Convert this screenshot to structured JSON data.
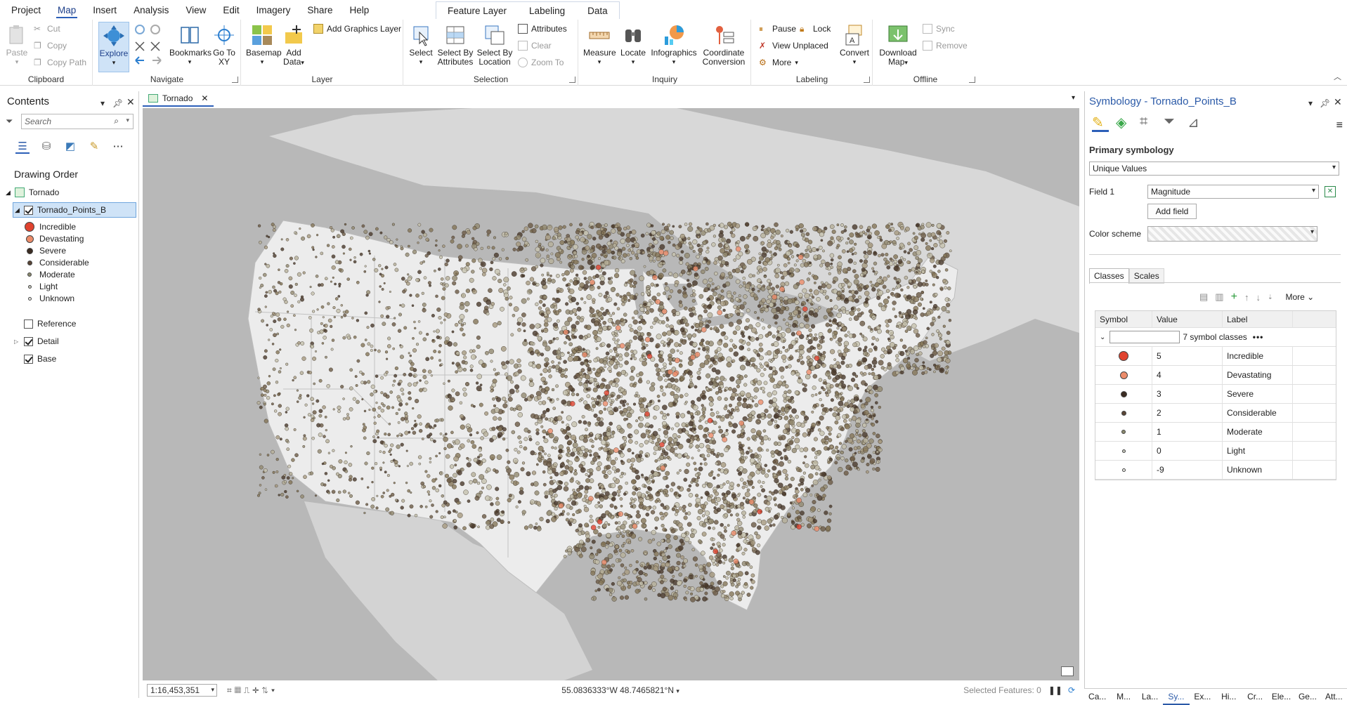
{
  "ribbon_tabs": [
    "Project",
    "Map",
    "Insert",
    "Analysis",
    "View",
    "Edit",
    "Imagery",
    "Share",
    "Help"
  ],
  "active_tab": "Map",
  "context_tabs": [
    "Feature Layer",
    "Labeling",
    "Data"
  ],
  "clipboard": {
    "paste": "Paste",
    "cut": "Cut",
    "copy": "Copy",
    "copy_path": "Copy Path",
    "label": "Clipboard"
  },
  "navigate": {
    "explore": "Explore",
    "bookmarks": "Bookmarks",
    "go_to_xy": "Go To XY",
    "label": "Navigate"
  },
  "layer": {
    "basemap": "Basemap",
    "add_data": "Add Data",
    "add_graphics": "Add Graphics Layer",
    "label": "Layer"
  },
  "selection": {
    "select": "Select",
    "select_by_attributes": "Select By Attributes",
    "select_by_location": "Select By Location",
    "attributes": "Attributes",
    "clear": "Clear",
    "zoom_to": "Zoom To",
    "label": "Selection"
  },
  "inquiry": {
    "measure": "Measure",
    "locate": "Locate",
    "infographics": "Infographics",
    "coord_conversion": "Coordinate Conversion",
    "label": "Inquiry"
  },
  "labeling": {
    "pause": "Pause",
    "lock": "Lock",
    "view_unplaced": "View Unplaced",
    "more": "More",
    "convert": "Convert",
    "label": "Labeling"
  },
  "offline": {
    "download_map": "Download Map",
    "sync": "Sync",
    "remove": "Remove",
    "label": "Offline"
  },
  "contents": {
    "title": "Contents",
    "search_placeholder": "Search",
    "drawing_order": "Drawing Order",
    "map_name": "Tornado",
    "layer_name": "Tornado_Points_B",
    "legend": [
      {
        "label": "Incredible",
        "color": "#e0432f"
      },
      {
        "label": "Devastating",
        "color": "#ec8c6a"
      },
      {
        "label": "Severe",
        "color": "#3b2c22"
      },
      {
        "label": "Considerable",
        "color": "#5a4535"
      },
      {
        "label": "Moderate",
        "color": "#8b8a6e"
      },
      {
        "label": "Light",
        "color": "#c9cbbf"
      },
      {
        "label": "Unknown",
        "color": "#ecece6"
      }
    ],
    "other_layers": [
      {
        "label": "Reference",
        "checked": false
      },
      {
        "label": "Detail",
        "checked": true
      },
      {
        "label": "Base",
        "checked": true
      }
    ]
  },
  "map": {
    "tab_label": "Tornado",
    "scale": "1:16,453,351",
    "coordinates": "55.0836333°W 48.7465821°N",
    "selected_features": "Selected Features: 0"
  },
  "symbology": {
    "title": "Symbology - Tornado_Points_B",
    "primary_label": "Primary symbology",
    "primary_value": "Unique Values",
    "field1_label": "Field 1",
    "field1_value": "Magnitude",
    "add_field": "Add field",
    "color_scheme_label": "Color scheme",
    "tabs": [
      "Classes",
      "Scales"
    ],
    "more": "More",
    "headers": [
      "Symbol",
      "Value",
      "Label"
    ],
    "group_text": "7 symbol classes",
    "classes": [
      {
        "value": "5",
        "label": "Incredible",
        "color": "#e0432f"
      },
      {
        "value": "4",
        "label": "Devastating",
        "color": "#ec8c6a"
      },
      {
        "value": "3",
        "label": "Severe",
        "color": "#3b2c22"
      },
      {
        "value": "2",
        "label": "Considerable",
        "color": "#5a4535"
      },
      {
        "value": "1",
        "label": "Moderate",
        "color": "#8b8a6e"
      },
      {
        "value": "0",
        "label": "Light",
        "color": "#c9cbbf"
      },
      {
        "value": "-9",
        "label": "Unknown",
        "color": "#ecece6"
      }
    ]
  },
  "dock_tabs": [
    "Ca...",
    "M...",
    "La...",
    "Sy...",
    "Ex...",
    "Hi...",
    "Cr...",
    "Ele...",
    "Ge...",
    "Att..."
  ],
  "active_dock": "Sy..."
}
